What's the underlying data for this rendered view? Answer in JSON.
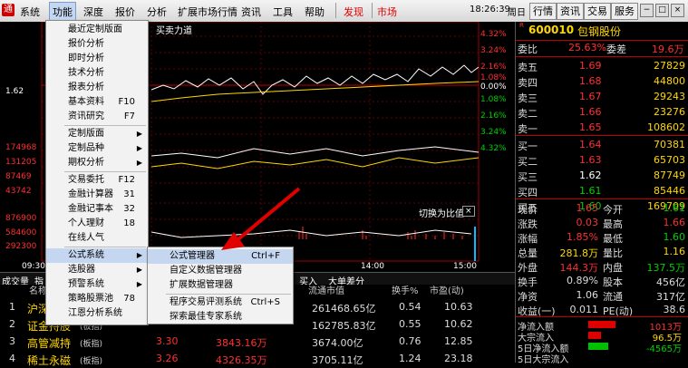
{
  "menubar": {
    "items": [
      "系统",
      "功能",
      "深度",
      "报价",
      "分析",
      "扩展市场行情",
      "资讯",
      "工具",
      "帮助"
    ],
    "highlight": [
      "发现",
      "市场"
    ],
    "time": "18:26:39",
    "weekday": "周日",
    "right_buttons": [
      "行情",
      "资讯",
      "交易",
      "服务"
    ],
    "window_buttons": [
      "−",
      "□",
      "×"
    ]
  },
  "chart": {
    "title": "买卖力道",
    "price_pct_labels": [
      "4.32%",
      "3.24%",
      "2.16%",
      "1.08%",
      "0.00%",
      "1.08%",
      "2.16%",
      "3.24%",
      "4.32%"
    ],
    "left_price_labels": [
      "1.62",
      "174968",
      "131205",
      "87469",
      "43742",
      "876900",
      "584600",
      "292300"
    ],
    "vol_labels": [
      "876900",
      "584600",
      "292300"
    ],
    "toggle_text": "切换为比值",
    "time_axis": [
      "09:30",
      "14:00",
      "15:00"
    ]
  },
  "stock": {
    "code": "600010",
    "name": "包钢股份",
    "weibi_label": "委比",
    "weibi": "25.63%",
    "weicha_label": "委差",
    "weicha": "19.6万",
    "asks": [
      {
        "label": "卖五",
        "price": "1.69",
        "vol": "27829"
      },
      {
        "label": "卖四",
        "price": "1.68",
        "vol": "44800"
      },
      {
        "label": "卖三",
        "price": "1.67",
        "vol": "29243"
      },
      {
        "label": "卖二",
        "price": "1.66",
        "vol": "23276"
      },
      {
        "label": "卖一",
        "price": "1.65",
        "vol": "108602"
      }
    ],
    "bids": [
      {
        "label": "买一",
        "price": "1.64",
        "vol": "70381"
      },
      {
        "label": "买二",
        "price": "1.63",
        "vol": "65703"
      },
      {
        "label": "买三",
        "price": "1.62",
        "vol": "87749"
      },
      {
        "label": "买四",
        "price": "1.61",
        "vol": "85446"
      },
      {
        "label": "买五",
        "price": "1.60",
        "vol": "169709"
      }
    ],
    "quote": [
      {
        "l1": "现价",
        "v1": "1.65",
        "l2": "今开",
        "v2": "1.61"
      },
      {
        "l1": "涨跌",
        "v1": "0.03",
        "l2": "最高",
        "v2": "1.66"
      },
      {
        "l1": "涨幅",
        "v1": "1.85%",
        "l2": "最低",
        "v2": "1.60"
      },
      {
        "l1": "总量",
        "v1": "281.8万",
        "l2": "量比",
        "v2": "1.16"
      },
      {
        "l1": "外盘",
        "v1": "144.3万",
        "l2": "内盘",
        "v2": "137.5万"
      },
      {
        "l1": "换手",
        "v1": "0.89%",
        "l2": "股本",
        "v2": "456亿"
      },
      {
        "l1": "净资",
        "v1": "1.06",
        "l2": "流通",
        "v2": "317亿"
      },
      {
        "l1": "收益(一)",
        "v1": "0.011",
        "l2": "PE(动)",
        "v2": "38.6"
      }
    ],
    "flows": [
      {
        "label": "净流入额",
        "value": "1013万"
      },
      {
        "label": "大宗流入",
        "value": "96.5万"
      },
      {
        "label": "5日净流入额",
        "value": "-4565万"
      },
      {
        "label": "5日大宗流入",
        "value": ""
      }
    ]
  },
  "func_menu": [
    {
      "label": "最近定制版面",
      "key": "",
      "sub": false
    },
    {
      "label": "报价分析",
      "key": "",
      "sub": false
    },
    {
      "label": "即时分析",
      "key": "",
      "sub": false
    },
    {
      "label": "技术分析",
      "key": "",
      "sub": false
    },
    {
      "label": "报表分析",
      "key": "",
      "sub": false
    },
    {
      "label": "基本资料",
      "key": "F10",
      "sub": false
    },
    {
      "label": "资讯研究",
      "key": "F7",
      "sub": false
    },
    {
      "label": "定制版面",
      "key": "",
      "sub": true
    },
    {
      "label": "定制品种",
      "key": "",
      "sub": true
    },
    {
      "label": "期权分析",
      "key": "",
      "sub": true
    },
    {
      "label": "交易委托",
      "key": "F12",
      "sub": false
    },
    {
      "label": "金融计算器",
      "key": "31",
      "sub": false
    },
    {
      "label": "金融记事本",
      "key": "32",
      "sub": false
    },
    {
      "label": "个人理财",
      "key": "18",
      "sub": false
    },
    {
      "label": "在线人气",
      "key": "",
      "sub": false
    },
    {
      "label": "公式系统",
      "key": "",
      "sub": true
    },
    {
      "label": "选股器",
      "key": "",
      "sub": true
    },
    {
      "label": "预警系统",
      "key": "",
      "sub": true
    },
    {
      "label": "策略股票池",
      "key": "78",
      "sub": false
    },
    {
      "label": "江恩分析系统",
      "key": "",
      "sub": false
    }
  ],
  "sub_menu": [
    {
      "label": "公式管理器",
      "key": "Ctrl+F"
    },
    {
      "label": "自定义数据管理器",
      "key": ""
    },
    {
      "label": "扩展数据管理器",
      "key": ""
    },
    {
      "label": "程序交易评测系统",
      "key": "Ctrl+S"
    },
    {
      "label": "探索最佳专家系统",
      "key": ""
    }
  ],
  "tabs": [
    "成交量",
    "指",
    "板块热点",
    "大单差分"
  ],
  "tabs_partial": "买入",
  "table": {
    "headers": [
      "名称",
      "流通市值",
      "换手%",
      "市盈(动)"
    ],
    "rows": [
      {
        "no": "1",
        "name": "沪深",
        "tag": "",
        "mv": "261468.65亿",
        "turn": "0.54",
        "pe": "10.63"
      },
      {
        "no": "2",
        "name": "证金持股",
        "tag": "(板指)",
        "mv": "162785.83亿",
        "turn": "0.55",
        "pe": "10.62"
      },
      {
        "no": "3",
        "name": "高管减持",
        "tag": "(板指)",
        "mv": "3674.00亿",
        "turn": "0.76",
        "pe": "12.85"
      },
      {
        "no": "4",
        "name": "稀土永磁",
        "tag": "(板指)",
        "mv": "3705.11亿",
        "turn": "1.24",
        "pe": "23.18"
      }
    ],
    "row_vals": [
      {
        "pct": "",
        "vol": ""
      },
      {
        "pct": "",
        "vol": ""
      },
      {
        "pct": "3.30",
        "vol": "3843.16万"
      },
      {
        "pct": "3.26",
        "vol": "4326.35万"
      }
    ]
  }
}
